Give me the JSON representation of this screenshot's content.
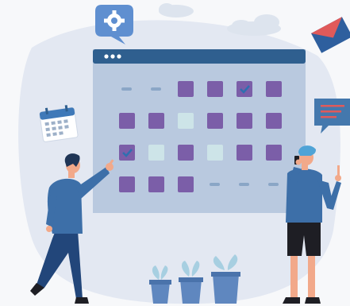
{
  "colors": {
    "background": "#f7f8fa",
    "blob": "#e3e8f2",
    "cloud": "#dde4ee",
    "window_frame": "#2f5f8f",
    "window_body": "#b9c9df",
    "tile_purple": "#7b5ea8",
    "tile_light": "#cde4e8",
    "dash": "#8aa6c6",
    "blue_shirt": "#3d6fa8",
    "dark_blue": "#22467a",
    "hair": "#1f3556",
    "skin": "#f2a98a",
    "shorts": "#1e1e24",
    "pot": "#5f87bf",
    "plant": "#a7cfe1",
    "envelope": "#e05a5a",
    "chat_bubble": "#4478ad",
    "gear_bubble": "#5f8fd0"
  },
  "window": {
    "dots": 3,
    "grid": [
      [
        "dash",
        "dash",
        "purple",
        "purple",
        "purple-check",
        "purple"
      ],
      [
        "purple",
        "purple",
        "light",
        "purple",
        "purple",
        "purple"
      ],
      [
        "purple-check",
        "light",
        "purple",
        "light",
        "purple",
        "purple"
      ],
      [
        "purple",
        "purple",
        "purple",
        "dash",
        "dash",
        "dash"
      ]
    ]
  },
  "icons": {
    "settings": "gear-icon",
    "calendar": "calendar-icon",
    "mail": "envelope-icon",
    "message": "chat-bubble-icon"
  },
  "plants": 3
}
